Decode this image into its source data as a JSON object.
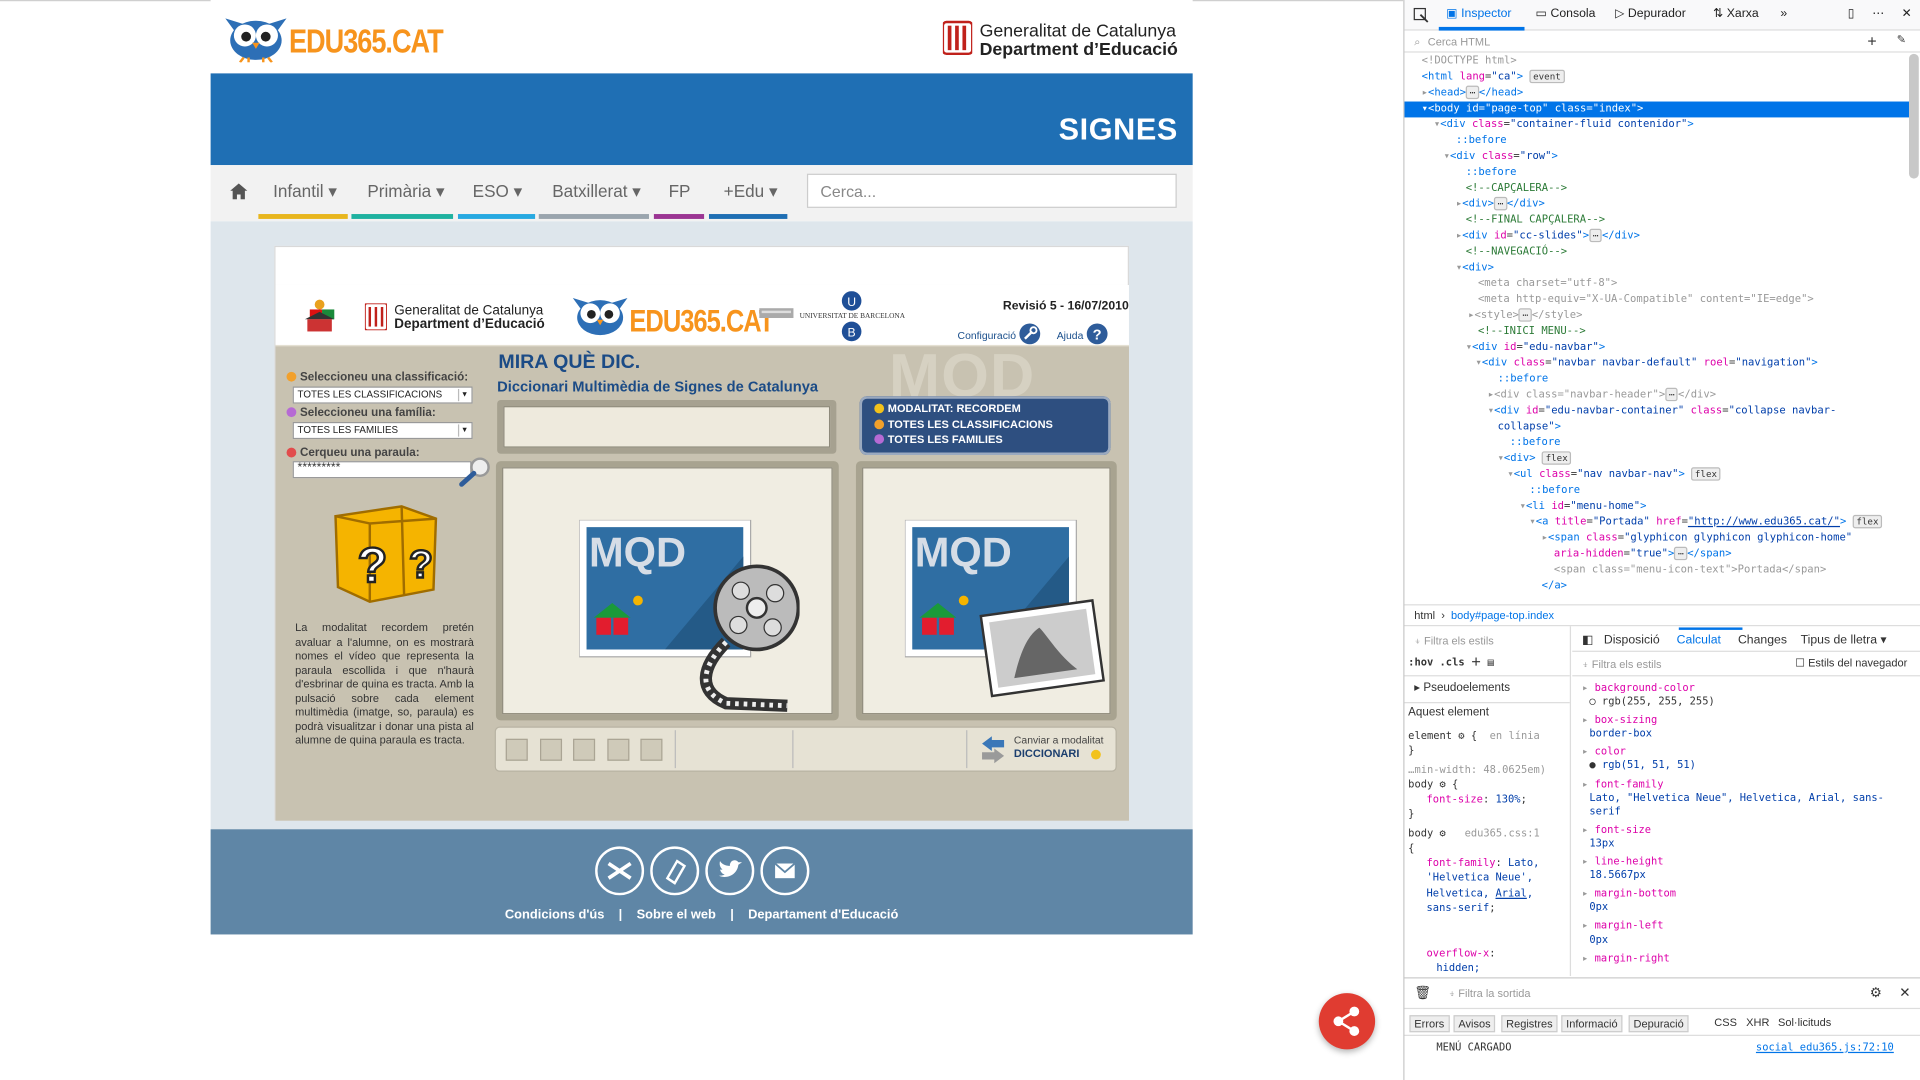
{
  "site": {
    "logo_text": "EDU365.CAT",
    "gencat_line1": "Generalitat de Catalunya",
    "gencat_line2": "Department d’Educació",
    "banner_title": "SIGNES"
  },
  "nav": {
    "items": [
      {
        "label": "Infantil",
        "color": "#e8b61e"
      },
      {
        "label": "Primària",
        "color": "#1fb2a0"
      },
      {
        "label": "ESO",
        "color": "#27a9e1"
      },
      {
        "label": "Batxillerat",
        "color": "#9aa5ae"
      },
      {
        "label": "FP",
        "color": "#9b3593"
      },
      {
        "label": "+Edu",
        "color": "#1f6fb4"
      }
    ],
    "search_placeholder": "Cerca..."
  },
  "app": {
    "logo2_text": "EDU365.CAT",
    "gen_line1": "Generalitat de Catalunya",
    "gen_line2": "Department d’Educació",
    "ub": "UNIVERSITAT DE BARCELONA",
    "revision": "Revisió 5 - 16/07/2010",
    "config": "Configuració",
    "help": "Ajuda",
    "label_class": "Seleccioneu una classificació:",
    "select_class": "TOTES LES CLASSIFICACIONS",
    "label_family": "Seleccioneu una família:",
    "select_family": "TOTES LES FAMILIES",
    "label_word": "Cerqueu una paraula:",
    "word_value": "*********",
    "description": "La modalitat recordem pretén avaluar a l'alumne, on es mostrarà nomes el vídeo que representa la paraula escollida i que n'haurà d'esbrinar de quina es tracta. Amb la pulsació sobre cada element multimèdia (imatge, so, paraula) es podrà visualitzar i donar una pista al alumne de quina paraula es tracta.",
    "title": "MIRA QUÈ DIC.",
    "subtitle": "Diccionari Multimèdia de Signes de Catalunya",
    "watermark": "MQD",
    "modal": [
      "MODALITAT: RECORDEM",
      "TOTES LES CLASSIFICACIONS",
      "TOTES LES FAMILIES"
    ],
    "card_label": "MQD",
    "change_line1": "Canviar a modalitat",
    "change_line2": "DICCIONARI"
  },
  "footer": {
    "links": [
      "Condicions d'ús",
      "|",
      "Sobre el web",
      "|",
      "Departament d'Educació"
    ]
  },
  "devtools": {
    "tabs": [
      "Inspector",
      "Consola",
      "Depurador",
      "Xarxa"
    ],
    "search": "Cerca HTML",
    "breadcrumb": [
      "html",
      "body#page-top.index"
    ],
    "left_tabs_filter": "Filtra els estils",
    "hov": ":hov",
    ".cls": ".cls",
    "pseudo": "Pseudoelements",
    "this_element": "Aquest element",
    "right_tabs": [
      "Disposició",
      "Calculat",
      "Changes",
      "Tipus de lletra"
    ],
    "filter2": "Filtra els estils",
    "browser_styles": "Estils del navegador",
    "console_filter": "Filtra la sortida",
    "console_tabs": [
      "Errors",
      "Avisos",
      "Registres",
      "Informació",
      "Depuració",
      "CSS",
      "XHR",
      "Sol·licituds"
    ],
    "console_msg": "MENÚ CARGADO",
    "console_src": "social_edu365.js:72:10"
  }
}
